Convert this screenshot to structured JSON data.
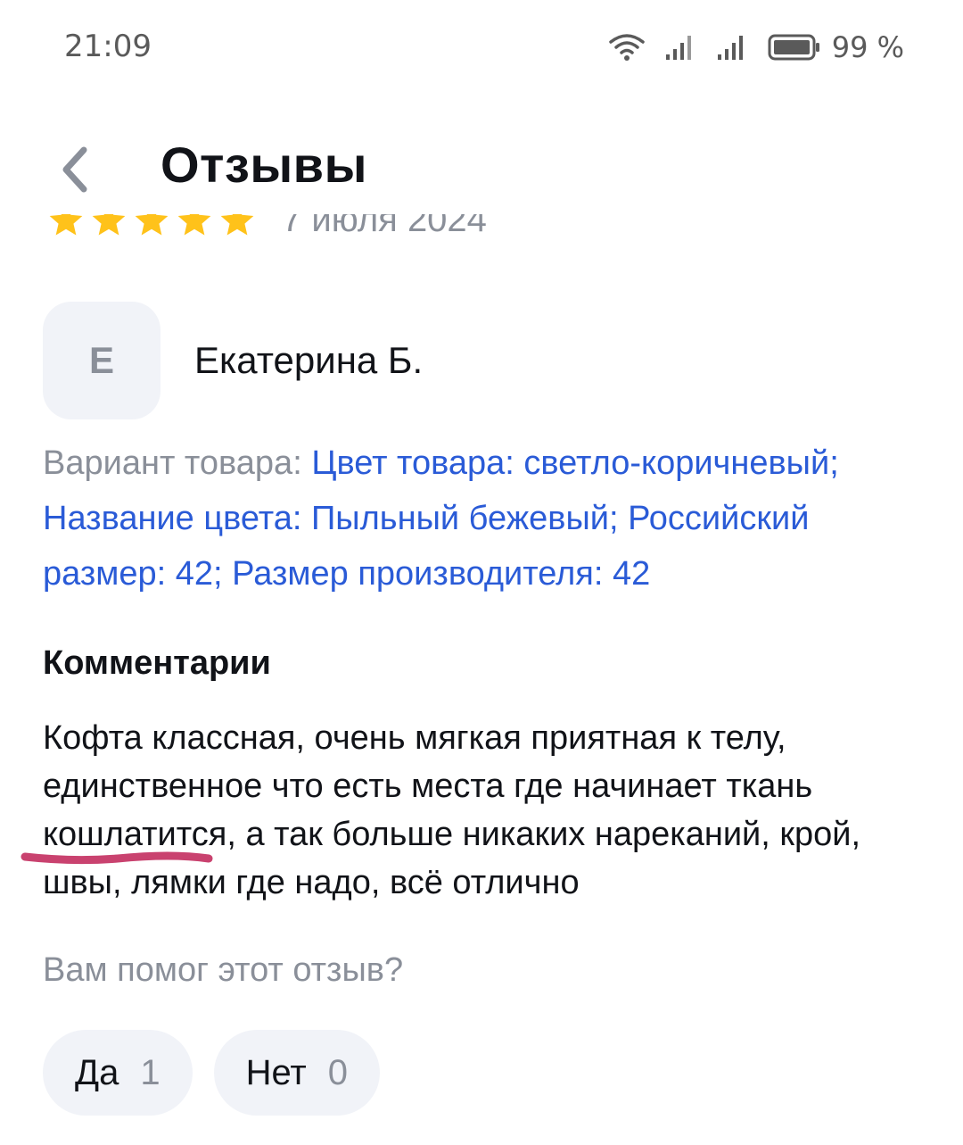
{
  "status_bar": {
    "time": "21:09",
    "battery_percent": "99 %",
    "icons": [
      "wifi-icon",
      "signal-icon",
      "signal-icon",
      "battery-icon"
    ]
  },
  "header": {
    "title": "Отзывы",
    "back_icon": "chevron-left-icon"
  },
  "previous_review": {
    "rating": 5,
    "date": "7 июля 2024"
  },
  "review": {
    "avatar_letter": "Е",
    "author": "Екатерина Б.",
    "variant_label": "Вариант товара:",
    "variant_value": "Цвет товара: светло-коричневый; Название цвета: Пыльный бежевый; Российский размер: 42; Размер производителя: 42",
    "comments_heading": "Комментарии",
    "comment_text": "Кофта классная, очень мягкая приятная к телу, единственное что есть места где начинает ткань кошлатится, а так больше никаких нареканий, крой, швы, лямки где надо, всё отлично",
    "helpful_question": "Вам помог этот отзыв?",
    "votes": {
      "yes_label": "Да",
      "yes_count": "1",
      "no_label": "Нет",
      "no_count": "0"
    }
  },
  "colors": {
    "accent_link": "#2a5bd7",
    "star": "#ffc21a",
    "muted_text": "#8a8f99",
    "chip_bg": "#f1f3f8",
    "scribble": "#c9426f"
  }
}
